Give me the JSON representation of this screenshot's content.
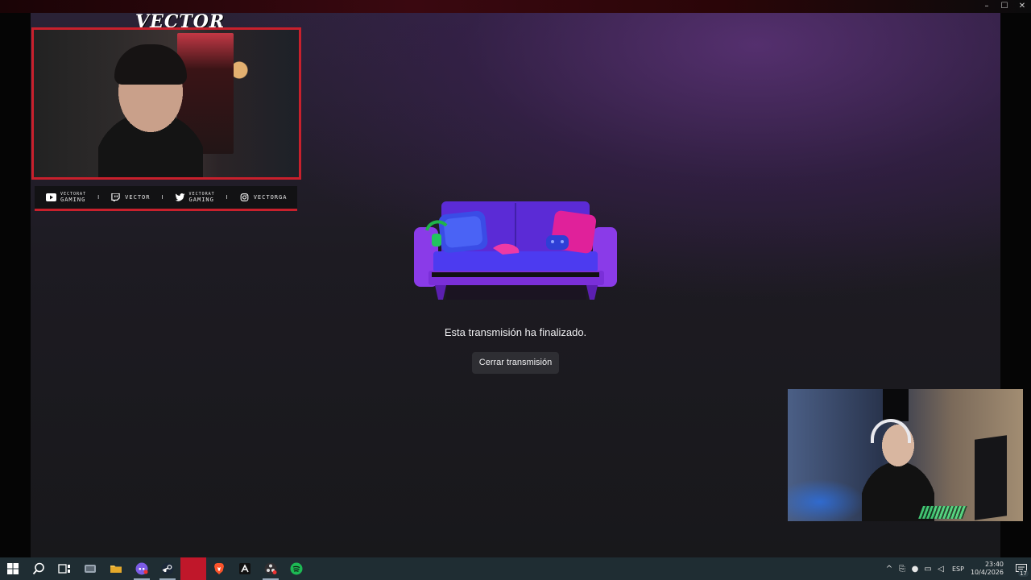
{
  "window": {
    "controls": [
      "–",
      "☐",
      "✕"
    ]
  },
  "overlay": {
    "logo_text": "VECTOR",
    "social": [
      {
        "icon": "youtube-icon",
        "small": "VECTORAT",
        "label": "GAMING"
      },
      {
        "icon": "twitch-icon",
        "small": "",
        "label": "VECTOR"
      },
      {
        "icon": "twitter-icon",
        "small": "VECTORAT",
        "label": "GAMING"
      },
      {
        "icon": "instagram-icon",
        "small": "",
        "label": "VECTORGA"
      }
    ],
    "separator": "I",
    "accent_color": "#c8202c"
  },
  "stream": {
    "end_message": "Esta transmisión ha finalizado.",
    "close_button": "Cerrar transmisión"
  },
  "taskbar": {
    "apps": [
      "start-icon",
      "search-icon",
      "task-view-icon",
      "app-icon",
      "file-explorer-icon",
      "discord-icon",
      "steam-icon",
      "app-red-icon",
      "brave-icon",
      "epic-icon",
      "obs-icon",
      "spotify-icon"
    ],
    "tray": {
      "language": "ESP",
      "time": "23:40",
      "date": "10/4/2026",
      "notifications": "17"
    }
  }
}
